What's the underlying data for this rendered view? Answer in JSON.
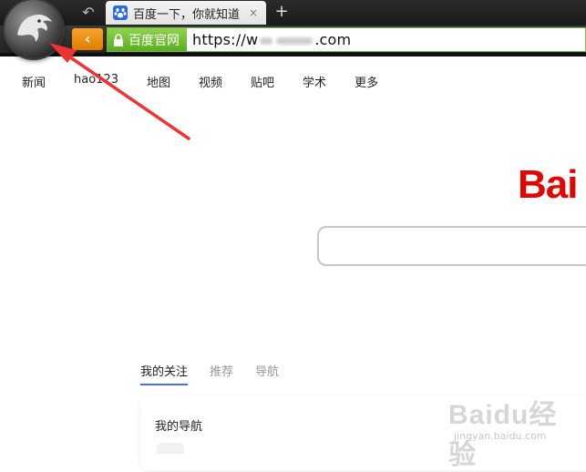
{
  "browser": {
    "tab_title": "百度一下，你就知道",
    "tab_close": "×",
    "new_tab": "+",
    "undo": "↶",
    "back": "‹",
    "site_badge": "百度官网",
    "url_prefix": "https://w",
    "url_suffix": ".com",
    "icons": [
      "browser-logo-icon",
      "lock-icon",
      "paw-favicon-icon"
    ]
  },
  "topnav": {
    "items": [
      "新闻",
      "hao123",
      "地图",
      "视频",
      "贴吧",
      "学术",
      "更多"
    ]
  },
  "brand": {
    "logo_text": "Bai"
  },
  "search": {
    "value": ""
  },
  "content": {
    "tabs": [
      "我的关注",
      "推荐",
      "导航"
    ],
    "active_tab": "我的关注",
    "card_title": "我的导航"
  },
  "watermark": {
    "text": "Baidu经验",
    "sub": "jingyan.baidu.com"
  },
  "colors": {
    "accent": "#4e6ef2",
    "brand_red": "#e10601",
    "badge_green": "#6bbd2e",
    "back_orange": "#f08c10",
    "arrow_red": "#ee3333"
  }
}
